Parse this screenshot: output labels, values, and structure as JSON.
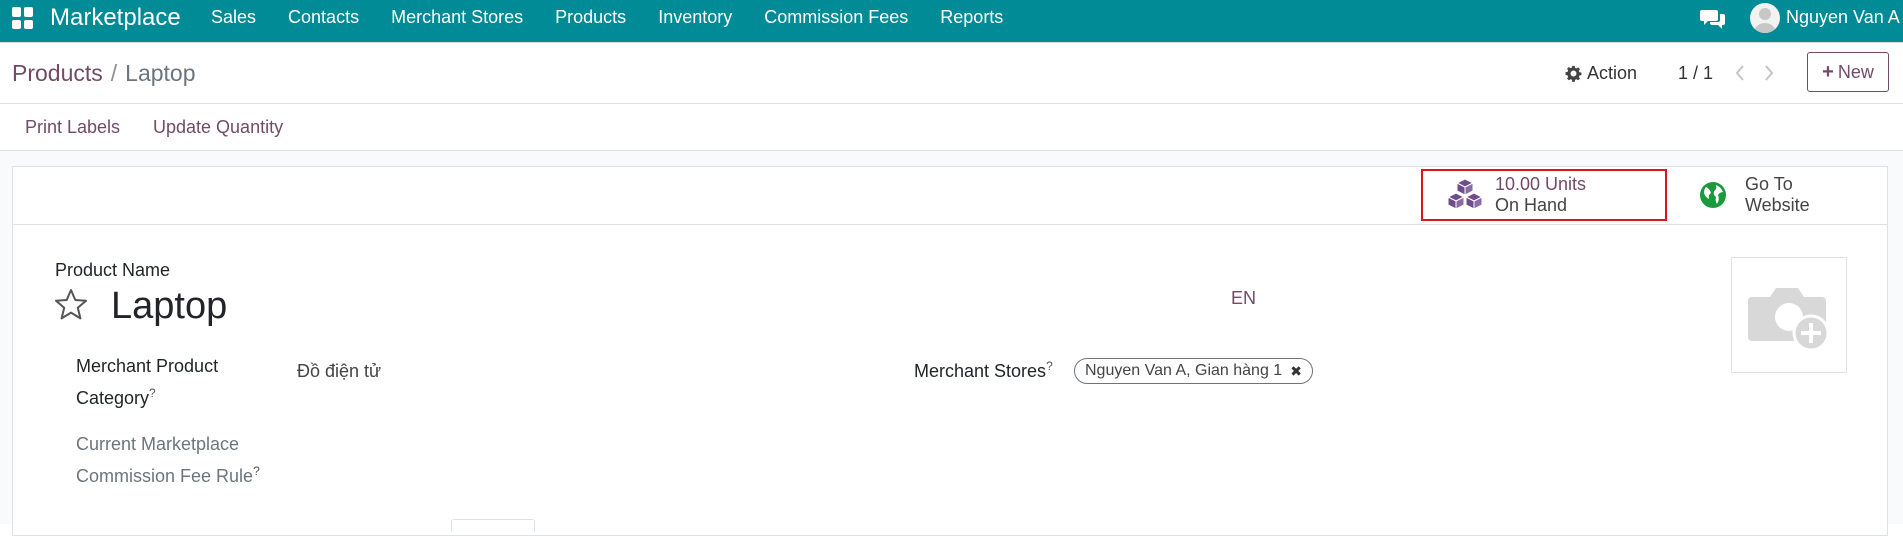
{
  "navbar": {
    "brand": "Marketplace",
    "menu": [
      "Sales",
      "Contacts",
      "Merchant Stores",
      "Products",
      "Inventory",
      "Commission Fees",
      "Reports"
    ],
    "user_name": "Nguyen Van A",
    "color": "#018b96"
  },
  "breadcrumb": {
    "parent": "Products",
    "separator": "/",
    "current": "Laptop"
  },
  "control": {
    "action_label": "Action",
    "pager": "1 / 1",
    "new_label": "New"
  },
  "statusbar": {
    "print_labels": "Print Labels",
    "update_quantity": "Update Quantity"
  },
  "stat_buttons": {
    "units_value": "10.00 Units",
    "units_label": "On Hand",
    "website_line1": "Go To",
    "website_line2": "Website"
  },
  "form": {
    "product_name_label": "Product Name",
    "product_name": "Laptop",
    "lang": "EN",
    "merchant_category_label_1": "Merchant Product",
    "merchant_category_label_2": "Category",
    "merchant_category_value": "Đồ điện tử",
    "commission_label_1": "Current Marketplace",
    "commission_label_2": "Commission Fee Rule",
    "merchant_stores_label": "Merchant Stores",
    "merchant_store_tag": "Nguyen Van A, Gian hàng 1",
    "help_mark": "?"
  },
  "colors": {
    "accent": "#714b67",
    "highlight_border": "#e0121b"
  },
  "icons": [
    "apps-icon",
    "chat-icon",
    "avatar",
    "gear-icon",
    "chevron-left-icon",
    "chevron-right-icon",
    "plus-icon",
    "cubes-icon",
    "globe-icon",
    "star-icon",
    "camera-plus-icon",
    "close-icon"
  ]
}
